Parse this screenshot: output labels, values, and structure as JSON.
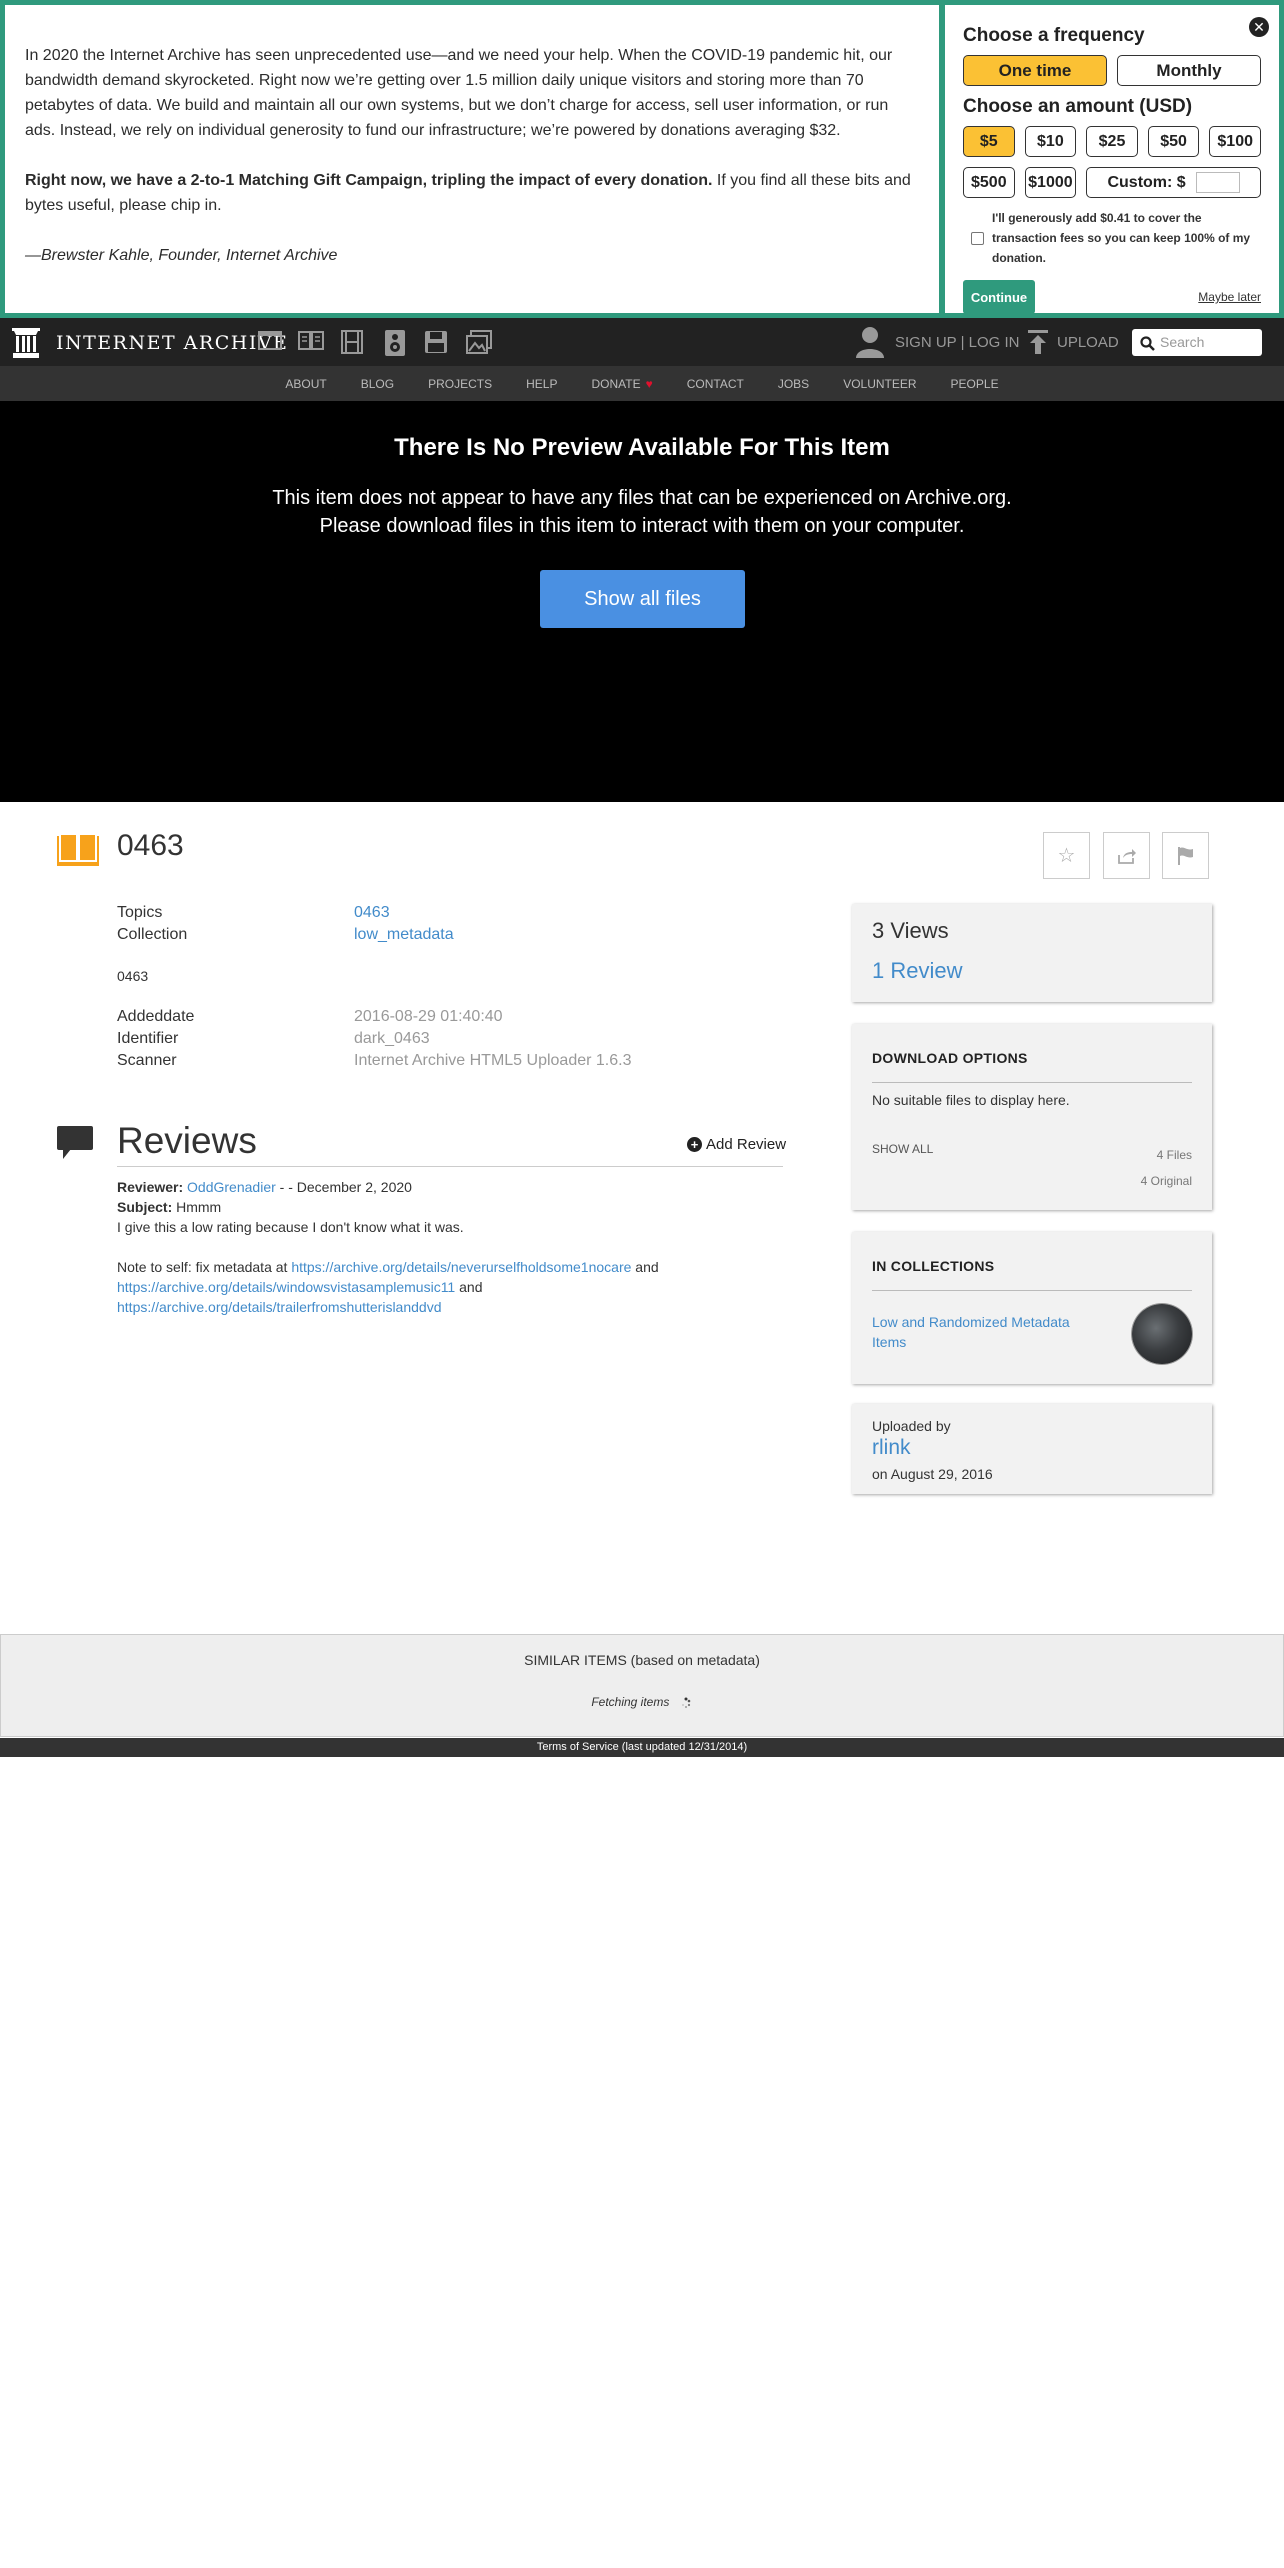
{
  "donation": {
    "message": {
      "paragraph1": "In 2020 the Internet Archive has seen unprecedented use—and we need your help. When the COVID-19 pandemic hit, our bandwidth demand skyrocketed. Right now we’re getting over 1.5 million daily unique visitors and storing more than 70 petabytes of data. We build and maintain all our own systems, but we don’t charge for access, sell user information, or run ads. Instead, we rely on individual generosity to fund our infrastructure; we’re powered by donations averaging $32.",
      "paragraph2_bold": "Right now, we have a 2-to-1 Matching Gift Campaign, tripling the impact of every donation.",
      "paragraph2_rest": " If you find all these bits and bytes useful, please chip in.",
      "signature": "—Brewster Kahle, Founder, Internet Archive"
    },
    "form": {
      "frequency_heading": "Choose a frequency",
      "frequencies": [
        "One time",
        "Monthly"
      ],
      "amount_heading": "Choose an amount (USD)",
      "amounts": [
        "$5",
        "$10",
        "$25",
        "$50",
        "$100",
        "$500",
        "$1000"
      ],
      "custom_label": "Custom: $",
      "fee_text": "I'll generously add $0.41 to cover the transaction fees so you can keep 100% of my donation.",
      "continue_label": "Continue",
      "maybe_later_label": "Maybe later",
      "close_symbol": "✕"
    },
    "colors": {
      "accent": "#2f9a7d",
      "selected": "#fbc134"
    }
  },
  "topnav": {
    "logo_text": "INTERNET ARCHIVE",
    "signup_login": "SIGN UP | LOG IN",
    "upload_label": "UPLOAD",
    "search_placeholder": "Search",
    "media_icons": [
      "web-icon",
      "texts-icon",
      "video-icon",
      "audio-icon",
      "software-icon",
      "images-icon"
    ]
  },
  "subnav": {
    "items": [
      "ABOUT",
      "BLOG",
      "PROJECTS",
      "HELP",
      "DONATE",
      "CONTACT",
      "JOBS",
      "VOLUNTEER",
      "PEOPLE"
    ],
    "donate_heart": "♥"
  },
  "theater": {
    "title": "There Is No Preview Available For This Item",
    "line1": "This item does not appear to have any files that can be experienced on Archive.org.",
    "line2": "Please download files in this item to interact with them on your computer.",
    "button_label": "Show all files"
  },
  "item": {
    "title": "0463",
    "actions": {
      "favorite": "☆",
      "share": "⇪",
      "flag": "⚑"
    },
    "metadata": {
      "topics_label": "Topics",
      "topics_value": "0463",
      "collection_label": "Collection",
      "collection_value": "low_metadata",
      "description": "0463",
      "addeddate_label": "Addeddate",
      "addeddate_value": "2016-08-29 01:40:40",
      "identifier_label": "Identifier",
      "identifier_value": "dark_0463",
      "scanner_label": "Scanner",
      "scanner_value": "Internet Archive HTML5 Uploader 1.6.3"
    }
  },
  "reviews": {
    "heading": "Reviews",
    "add_review_label": "Add Review",
    "add_review_symbol": "+",
    "entry": {
      "reviewer_label": "Reviewer:",
      "reviewer_name": "OddGrenadier",
      "date_text": " - - December 2, 2020",
      "subject_label": "Subject:",
      "subject_value": "Hmmm",
      "body_line1": "I give this a low rating because I don't know what it was.",
      "note_prefix": "Note to self: fix metadata at ",
      "link1": "https://archive.org/details/neverurselfholdsome1nocare",
      "and1": " and",
      "link2": "https://archive.org/details/windowsvistasamplemusic11",
      "and2": " and",
      "link3": "https://archive.org/details/trailerfromshutterislanddvd"
    }
  },
  "sidebar": {
    "views": "3 Views",
    "reviews_count": "1 Review",
    "download": {
      "heading": "DOWNLOAD OPTIONS",
      "no_files": "No suitable files to display here.",
      "show_all": "SHOW ALL",
      "files_count": "4 Files",
      "original_count": "4 Original"
    },
    "collections": {
      "heading": "IN COLLECTIONS",
      "collection_name": "Low and Randomized Metadata Items"
    },
    "uploader": {
      "label": "Uploaded by",
      "name": "rlink",
      "date": "on August 29, 2016"
    }
  },
  "similar": {
    "heading": "SIMILAR ITEMS (based on metadata)",
    "fetching": "Fetching items"
  },
  "footer": {
    "terms": "Terms of Service (last updated 12/31/2014)"
  }
}
